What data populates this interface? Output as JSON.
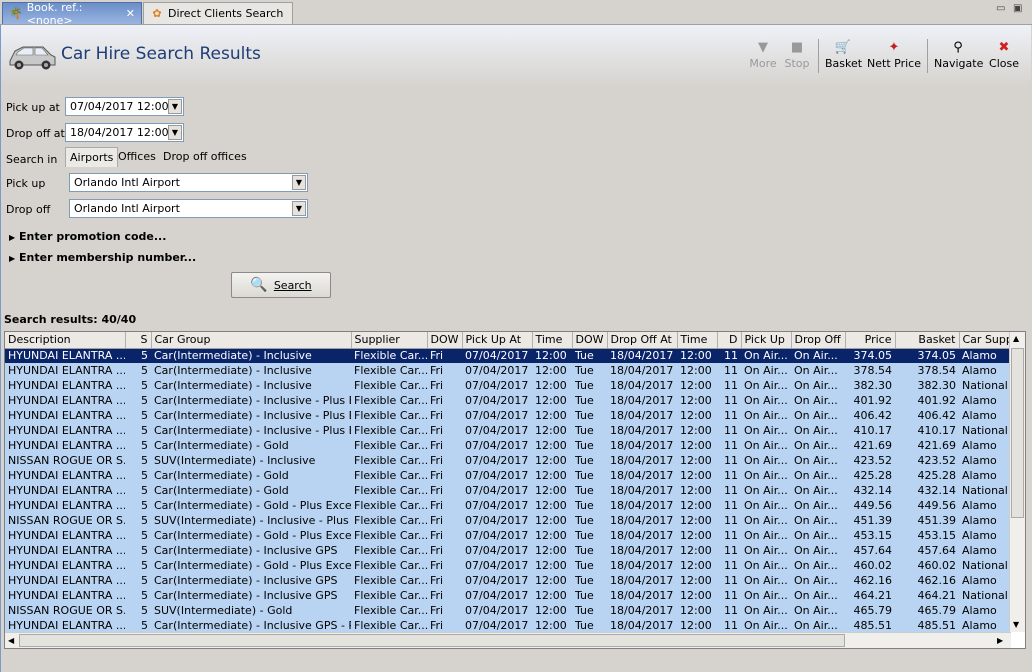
{
  "tabs": [
    {
      "label": "Book. ref.: <none>",
      "icon": "palm-tree-icon"
    },
    {
      "label": "Direct Clients Search",
      "icon": "flower-icon"
    }
  ],
  "header": {
    "title": "Car Hire Search Results"
  },
  "toolbar": {
    "more": "More",
    "stop": "Stop",
    "basket": "Basket",
    "nett_price": "Nett Price",
    "navigate": "Navigate",
    "close": "Close"
  },
  "form": {
    "pickup_at_label": "Pick up at",
    "pickup_at_value": "07/04/2017 12:00",
    "dropoff_at_label": "Drop off at",
    "dropoff_at_value": "18/04/2017 12:00",
    "search_in_label": "Search in",
    "search_in_options": [
      "Airports",
      "Offices",
      "Drop off offices"
    ],
    "pickup_label": "Pick up",
    "pickup_value": "Orlando Intl Airport",
    "dropoff_label": "Drop off",
    "dropoff_value": "Orlando Intl Airport",
    "promo": "Enter promotion code...",
    "membership": "Enter membership number...",
    "search_button": "Search"
  },
  "results": {
    "label": "Search results: 40/40",
    "columns": [
      "Description",
      "S",
      "Car Group",
      "Supplier",
      "DOW",
      "Pick Up At",
      "Time",
      "DOW",
      "Drop Off At",
      "Time",
      "D",
      "Pick Up",
      "Drop Off",
      "Price",
      "Basket",
      "Car Suppl"
    ],
    "rows": [
      [
        "HYUNDAI ELANTRA ...",
        "5",
        "Car(Intermediate) - Inclusive",
        "Flexible Car...",
        "Fri",
        "07/04/2017",
        "12:00",
        "Tue",
        "18/04/2017",
        "12:00",
        "11",
        "On Air...",
        "On Air...",
        "374.05",
        "374.05",
        "Alamo"
      ],
      [
        "HYUNDAI ELANTRA ...",
        "5",
        "Car(Intermediate) - Inclusive",
        "Flexible Car...",
        "Fri",
        "07/04/2017",
        "12:00",
        "Tue",
        "18/04/2017",
        "12:00",
        "11",
        "On Air...",
        "On Air...",
        "378.54",
        "378.54",
        "Alamo"
      ],
      [
        "HYUNDAI ELANTRA ...",
        "5",
        "Car(Intermediate) - Inclusive",
        "Flexible Car...",
        "Fri",
        "07/04/2017",
        "12:00",
        "Tue",
        "18/04/2017",
        "12:00",
        "11",
        "On Air...",
        "On Air...",
        "382.30",
        "382.30",
        "National"
      ],
      [
        "HYUNDAI ELANTRA ...",
        "5",
        "Car(Intermediate) - Inclusive - Plus E...",
        "Flexible Car...",
        "Fri",
        "07/04/2017",
        "12:00",
        "Tue",
        "18/04/2017",
        "12:00",
        "11",
        "On Air...",
        "On Air...",
        "401.92",
        "401.92",
        "Alamo"
      ],
      [
        "HYUNDAI ELANTRA ...",
        "5",
        "Car(Intermediate) - Inclusive - Plus E...",
        "Flexible Car...",
        "Fri",
        "07/04/2017",
        "12:00",
        "Tue",
        "18/04/2017",
        "12:00",
        "11",
        "On Air...",
        "On Air...",
        "406.42",
        "406.42",
        "Alamo"
      ],
      [
        "HYUNDAI ELANTRA ...",
        "5",
        "Car(Intermediate) - Inclusive - Plus E...",
        "Flexible Car...",
        "Fri",
        "07/04/2017",
        "12:00",
        "Tue",
        "18/04/2017",
        "12:00",
        "11",
        "On Air...",
        "On Air...",
        "410.17",
        "410.17",
        "National"
      ],
      [
        "HYUNDAI ELANTRA ...",
        "5",
        "Car(Intermediate) - Gold",
        "Flexible Car...",
        "Fri",
        "07/04/2017",
        "12:00",
        "Tue",
        "18/04/2017",
        "12:00",
        "11",
        "On Air...",
        "On Air...",
        "421.69",
        "421.69",
        "Alamo"
      ],
      [
        "NISSAN ROGUE OR S...",
        "5",
        "SUV(Intermediate) - Inclusive",
        "Flexible Car...",
        "Fri",
        "07/04/2017",
        "12:00",
        "Tue",
        "18/04/2017",
        "12:00",
        "11",
        "On Air...",
        "On Air...",
        "423.52",
        "423.52",
        "Alamo"
      ],
      [
        "HYUNDAI ELANTRA ...",
        "5",
        "Car(Intermediate) - Gold",
        "Flexible Car...",
        "Fri",
        "07/04/2017",
        "12:00",
        "Tue",
        "18/04/2017",
        "12:00",
        "11",
        "On Air...",
        "On Air...",
        "425.28",
        "425.28",
        "Alamo"
      ],
      [
        "HYUNDAI ELANTRA ...",
        "5",
        "Car(Intermediate) - Gold",
        "Flexible Car...",
        "Fri",
        "07/04/2017",
        "12:00",
        "Tue",
        "18/04/2017",
        "12:00",
        "11",
        "On Air...",
        "On Air...",
        "432.14",
        "432.14",
        "National"
      ],
      [
        "HYUNDAI ELANTRA ...",
        "5",
        "Car(Intermediate) - Gold - Plus Exces...",
        "Flexible Car...",
        "Fri",
        "07/04/2017",
        "12:00",
        "Tue",
        "18/04/2017",
        "12:00",
        "11",
        "On Air...",
        "On Air...",
        "449.56",
        "449.56",
        "Alamo"
      ],
      [
        "NISSAN ROGUE OR S...",
        "5",
        "SUV(Intermediate) - Inclusive - Plus E...",
        "Flexible Car...",
        "Fri",
        "07/04/2017",
        "12:00",
        "Tue",
        "18/04/2017",
        "12:00",
        "11",
        "On Air...",
        "On Air...",
        "451.39",
        "451.39",
        "Alamo"
      ],
      [
        "HYUNDAI ELANTRA ...",
        "5",
        "Car(Intermediate) - Gold - Plus Exces...",
        "Flexible Car...",
        "Fri",
        "07/04/2017",
        "12:00",
        "Tue",
        "18/04/2017",
        "12:00",
        "11",
        "On Air...",
        "On Air...",
        "453.15",
        "453.15",
        "Alamo"
      ],
      [
        "HYUNDAI ELANTRA ...",
        "5",
        "Car(Intermediate) - Inclusive GPS",
        "Flexible Car...",
        "Fri",
        "07/04/2017",
        "12:00",
        "Tue",
        "18/04/2017",
        "12:00",
        "11",
        "On Air...",
        "On Air...",
        "457.64",
        "457.64",
        "Alamo"
      ],
      [
        "HYUNDAI ELANTRA ...",
        "5",
        "Car(Intermediate) - Gold - Plus Exces...",
        "Flexible Car...",
        "Fri",
        "07/04/2017",
        "12:00",
        "Tue",
        "18/04/2017",
        "12:00",
        "11",
        "On Air...",
        "On Air...",
        "460.02",
        "460.02",
        "National"
      ],
      [
        "HYUNDAI ELANTRA ...",
        "5",
        "Car(Intermediate) - Inclusive GPS",
        "Flexible Car...",
        "Fri",
        "07/04/2017",
        "12:00",
        "Tue",
        "18/04/2017",
        "12:00",
        "11",
        "On Air...",
        "On Air...",
        "462.16",
        "462.16",
        "Alamo"
      ],
      [
        "HYUNDAI ELANTRA ...",
        "5",
        "Car(Intermediate) - Inclusive GPS",
        "Flexible Car...",
        "Fri",
        "07/04/2017",
        "12:00",
        "Tue",
        "18/04/2017",
        "12:00",
        "11",
        "On Air...",
        "On Air...",
        "464.21",
        "464.21",
        "National"
      ],
      [
        "NISSAN ROGUE OR S...",
        "5",
        "SUV(Intermediate) - Gold",
        "Flexible Car...",
        "Fri",
        "07/04/2017",
        "12:00",
        "Tue",
        "18/04/2017",
        "12:00",
        "11",
        "On Air...",
        "On Air...",
        "465.79",
        "465.79",
        "Alamo"
      ],
      [
        "HYUNDAI ELANTRA ...",
        "5",
        "Car(Intermediate) - Inclusive GPS - Pl...",
        "Flexible Car...",
        "Fri",
        "07/04/2017",
        "12:00",
        "Tue",
        "18/04/2017",
        "12:00",
        "11",
        "On Air...",
        "On Air...",
        "485.51",
        "485.51",
        "Alamo"
      ]
    ]
  }
}
